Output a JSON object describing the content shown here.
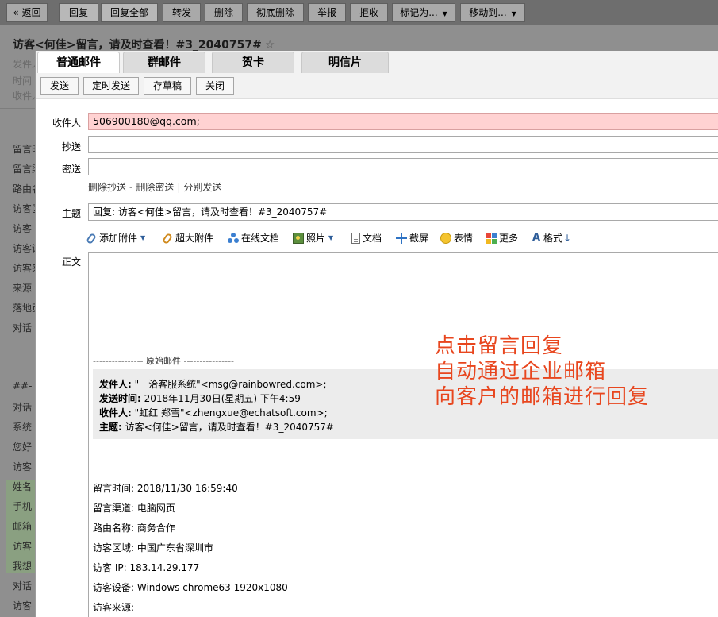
{
  "toolbar": {
    "back": "« 返回",
    "reply": "回复",
    "reply_all": "回复全部",
    "forward": "转发",
    "delete": "删除",
    "delete_permanent": "彻底删除",
    "report": "举报",
    "reject": "拒收",
    "mark_as": "标记为...",
    "move_to": "移动到..."
  },
  "background": {
    "subject": "访客<何佳>留言，请及时查看！#3_2040757#",
    "meta": [
      "发件人",
      "时间",
      "收件人"
    ],
    "lines": [
      "留言时间",
      "留言渠道",
      "路由名称",
      "访客区域",
      "访客",
      "访客设备",
      "访客来源",
      "来源",
      "落地页",
      "对话",
      "##-",
      "对话",
      "系统",
      "您好",
      "访客",
      "姓名",
      "手机",
      "邮箱",
      "访客",
      "我想",
      "对话",
      "访客"
    ]
  },
  "compose": {
    "tabs": [
      "普通邮件",
      "群邮件",
      "贺卡",
      "明信片"
    ],
    "actions": [
      "发送",
      "定时发送",
      "存草稿",
      "关闭"
    ],
    "to_label": "收件人",
    "to_value": "506900180@qq.com;",
    "cc_label": "抄送",
    "bcc_label": "密送",
    "cc_value": "",
    "bcc_value": "",
    "links": [
      "删除抄送",
      "删除密送",
      "分别发送"
    ],
    "subject_label": "主题",
    "subject_value": "回复: 访客<何佳>留言，请及时查看！#3_2040757#",
    "editor_tools": [
      "添加附件",
      "超大附件",
      "在线文档",
      "照片",
      "文档",
      "截屏",
      "表情",
      "更多",
      "格式"
    ],
    "body_label": "正文",
    "original_sep": "---------------- 原始邮件 ----------------",
    "quote": {
      "from_label": "发件人:",
      "from_value": "\"一洽客服系统\"<msg@rainbowred.com>;",
      "time_label": "发送时间:",
      "time_value": "2018年11月30日(星期五) 下午4:59",
      "to_label": "收件人:",
      "to_value": "\"虹红  郑雪\"<zhengxue@echatsoft.com>;",
      "subject_label": "主题:",
      "subject_value": "访客<何佳>留言，请及时查看！#3_2040757#"
    },
    "info": [
      "留言时间:  2018/11/30 16:59:40",
      "留言渠道:  电脑网页",
      "路由名称:  商务合作",
      "访客区域:  中国广东省深圳市",
      "访客    IP:  183.14.29.177",
      "访客设备:  Windows chrome63 1920x1080",
      "访客来源:"
    ]
  },
  "annotation": [
    "点击留言回复",
    "自动通过企业邮箱",
    "向客户的邮箱进行回复"
  ],
  "colors": {
    "annotation": "#e8461e",
    "to_field_bg": "#ffd2d2",
    "overlay": "#8f8f8f"
  }
}
